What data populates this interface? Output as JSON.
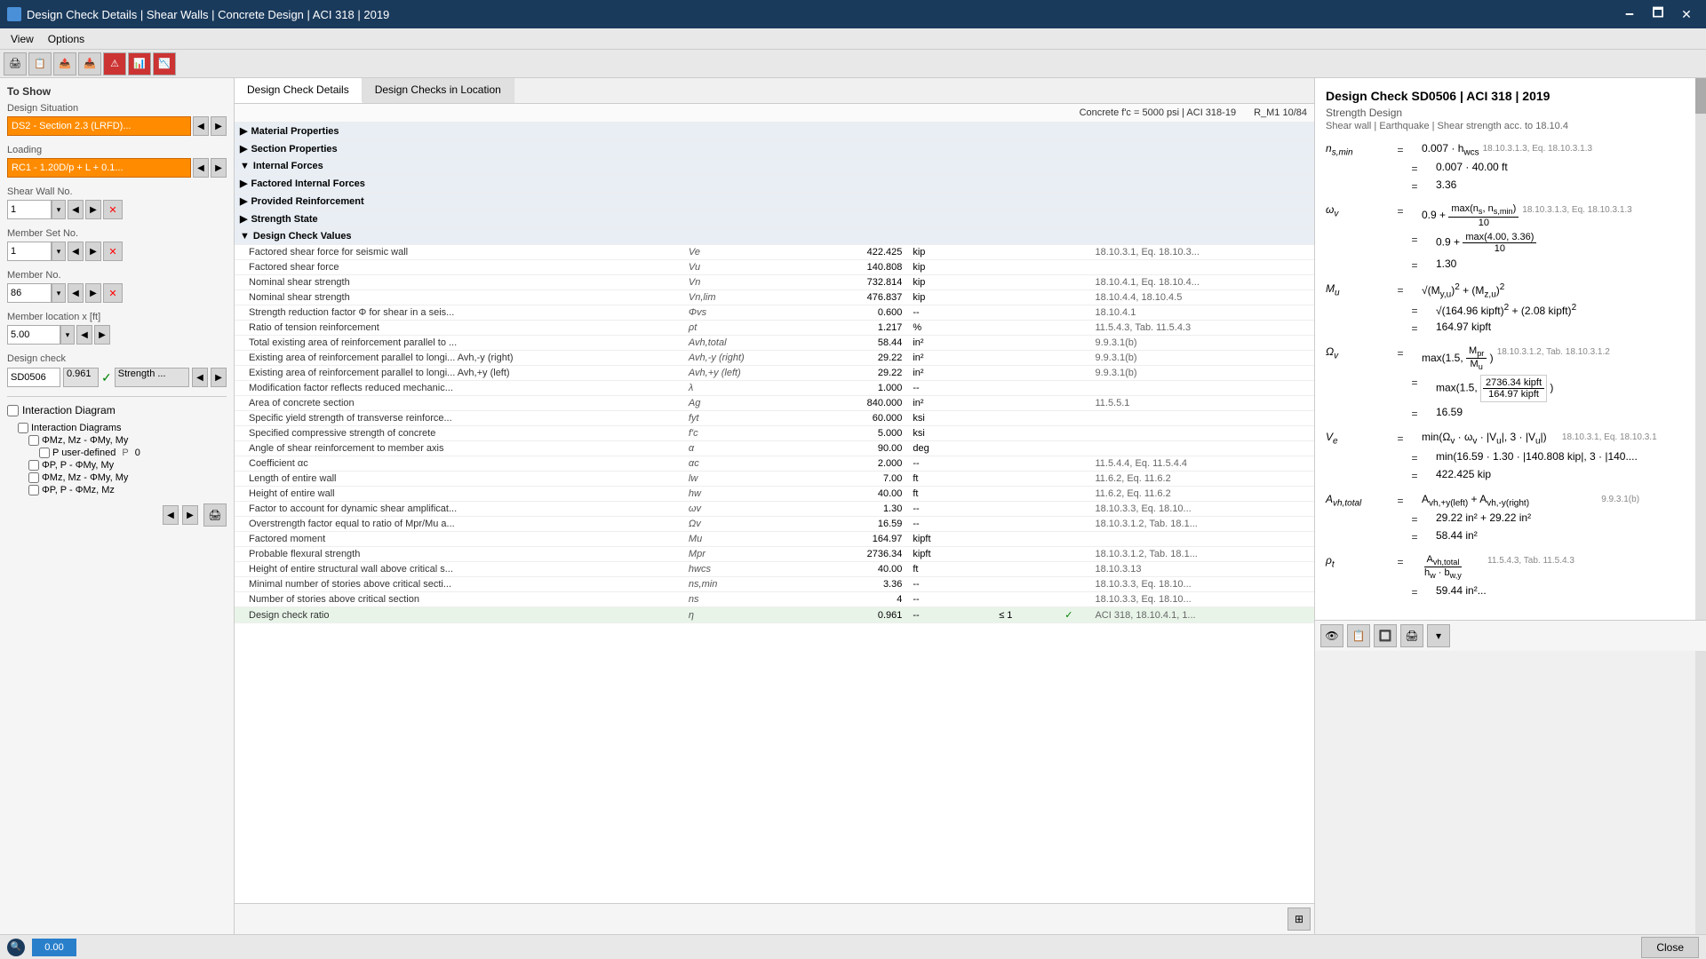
{
  "titleBar": {
    "title": "Design Check Details | Shear Walls | Concrete Design | ACI 318 | 2019",
    "minimize": "🗕",
    "maximize": "🗖",
    "close": "✕"
  },
  "menu": {
    "items": [
      "View",
      "Options"
    ]
  },
  "tabs": {
    "tab1": "Design Check Details",
    "tab2": "Design Checks in Location"
  },
  "infoBar": {
    "left": "Concrete f'c = 5000 psi | ACI 318-19",
    "right": "R_M1 10/84"
  },
  "toShow": {
    "header": "To Show",
    "situation": {
      "label": "Design Situation",
      "value": "DS2 - Section 2.3 (LRFD)..."
    },
    "loading": {
      "label": "Loading",
      "value": "RC1 - 1.20D/p + L + 0.1..."
    },
    "shearWall": {
      "label": "Shear Wall No.",
      "value": "1"
    },
    "memberSet": {
      "label": "Member Set No.",
      "value": "1"
    },
    "member": {
      "label": "Member No.",
      "value": "86"
    },
    "location": {
      "label": "Member location x [ft]",
      "value": "5.00"
    },
    "designCheck": {
      "label": "Design check",
      "code": "SD0506",
      "ratio": "0.961",
      "strength": "Strength ..."
    }
  },
  "interactionDiagram": {
    "label": "Interaction Diagram",
    "items": [
      "Interaction Diagrams",
      "ΦMz, Mz - ΦMy, My",
      "P user-defined",
      "ΦP, P - ΦMy, My",
      "ΦMz, Mz - ΦMy, My",
      "ΦP, P - ΦMz, Mz"
    ]
  },
  "sections": [
    {
      "id": "material",
      "label": "Material Properties",
      "expanded": false
    },
    {
      "id": "section",
      "label": "Section Properties",
      "expanded": false
    },
    {
      "id": "internal",
      "label": "Internal Forces",
      "expanded": true
    },
    {
      "id": "factored",
      "label": "Factored Internal Forces",
      "expanded": false
    },
    {
      "id": "provided",
      "label": "Provided Reinforcement",
      "expanded": false
    },
    {
      "id": "strength",
      "label": "Strength State",
      "expanded": false
    },
    {
      "id": "dcvalues",
      "label": "Design Check Values",
      "expanded": true
    }
  ],
  "tableRows": [
    {
      "name": "Factored shear force for seismic wall",
      "sym": "Ve",
      "val": "422.425",
      "unit": "kip",
      "limit": "",
      "status": "",
      "ref": "18.10.3.1, Eq. 18.10.3..."
    },
    {
      "name": "Factored shear force",
      "sym": "Vu",
      "val": "140.808",
      "unit": "kip",
      "limit": "",
      "status": "",
      "ref": ""
    },
    {
      "name": "Nominal shear strength",
      "sym": "Vn",
      "val": "732.814",
      "unit": "kip",
      "limit": "",
      "status": "",
      "ref": "18.10.4.1, Eq. 18.10.4..."
    },
    {
      "name": "Nominal shear strength",
      "sym": "Vn,lim",
      "val": "476.837",
      "unit": "kip",
      "limit": "",
      "status": "",
      "ref": "18.10.4.4, 18.10.4.5"
    },
    {
      "name": "Strength reduction factor Φ for shear in a seis...",
      "sym": "Φvs",
      "val": "0.600",
      "unit": "--",
      "limit": "",
      "status": "",
      "ref": "18.10.4.1"
    },
    {
      "name": "Ratio of tension reinforcement",
      "sym": "ρt",
      "val": "1.217",
      "unit": "%",
      "limit": "",
      "status": "",
      "ref": "11.5.4.3, Tab. 11.5.4.3"
    },
    {
      "name": "Total existing area of reinforcement parallel to ...",
      "sym": "Avh,total",
      "val": "58.44",
      "unit": "in²",
      "limit": "",
      "status": "",
      "ref": "9.9.3.1(b)"
    },
    {
      "name": "Existing area of reinforcement parallel to longi... Avh,-y (right)",
      "sym": "Avh,-y (right)",
      "val": "29.22",
      "unit": "in²",
      "limit": "",
      "status": "",
      "ref": "9.9.3.1(b)"
    },
    {
      "name": "Existing area of reinforcement parallel to longi... Avh,+y (left)",
      "sym": "Avh,+y (left)",
      "val": "29.22",
      "unit": "in²",
      "limit": "",
      "status": "",
      "ref": "9.9.3.1(b)"
    },
    {
      "name": "Modification factor reflects reduced mechanic...",
      "sym": "λ",
      "val": "1.000",
      "unit": "--",
      "limit": "",
      "status": "",
      "ref": ""
    },
    {
      "name": "Area of concrete section",
      "sym": "Ag",
      "val": "840.000",
      "unit": "in²",
      "limit": "",
      "status": "",
      "ref": "11.5.5.1"
    },
    {
      "name": "Specific yield strength of transverse reinforce...",
      "sym": "fyt",
      "val": "60.000",
      "unit": "ksi",
      "limit": "",
      "status": "",
      "ref": ""
    },
    {
      "name": "Specified compressive strength of concrete",
      "sym": "f'c",
      "val": "5.000",
      "unit": "ksi",
      "limit": "",
      "status": "",
      "ref": ""
    },
    {
      "name": "Angle of shear reinforcement to member axis",
      "sym": "α",
      "val": "90.00",
      "unit": "deg",
      "limit": "",
      "status": "",
      "ref": ""
    },
    {
      "name": "Coefficient αc",
      "sym": "αc",
      "val": "2.000",
      "unit": "--",
      "limit": "",
      "status": "",
      "ref": "11.5.4.4, Eq. 11.5.4.4"
    },
    {
      "name": "Length of entire wall",
      "sym": "lw",
      "val": "7.00",
      "unit": "ft",
      "limit": "",
      "status": "",
      "ref": "11.6.2, Eq. 11.6.2"
    },
    {
      "name": "Height of entire wall",
      "sym": "hw",
      "val": "40.00",
      "unit": "ft",
      "limit": "",
      "status": "",
      "ref": "11.6.2, Eq. 11.6.2"
    },
    {
      "name": "Factor to account for dynamic shear amplificat...",
      "sym": "ωv",
      "val": "1.30",
      "unit": "--",
      "limit": "",
      "status": "",
      "ref": "18.10.3.3, Eq. 18.10..."
    },
    {
      "name": "Overstrength factor equal to ratio of Mpr/Mu a...",
      "sym": "Ωv",
      "val": "16.59",
      "unit": "--",
      "limit": "",
      "status": "",
      "ref": "18.10.3.1.2, Tab. 18.1..."
    },
    {
      "name": "Factored moment",
      "sym": "Mu",
      "val": "164.97",
      "unit": "kipft",
      "limit": "",
      "status": "",
      "ref": ""
    },
    {
      "name": "Probable flexural strength",
      "sym": "Mpr",
      "val": "2736.34",
      "unit": "kipft",
      "limit": "",
      "status": "",
      "ref": "18.10.3.1.2, Tab. 18.1..."
    },
    {
      "name": "Height of entire structural wall above critical s...",
      "sym": "hwcs",
      "val": "40.00",
      "unit": "ft",
      "limit": "",
      "status": "",
      "ref": "18.10.3.13"
    },
    {
      "name": "Minimal number of stories above critical secti...",
      "sym": "ns,min",
      "val": "3.36",
      "unit": "--",
      "limit": "",
      "status": "",
      "ref": "18.10.3.3, Eq. 18.10..."
    },
    {
      "name": "Number of stories above critical section",
      "sym": "ns",
      "val": "4",
      "unit": "--",
      "limit": "",
      "status": "",
      "ref": "18.10.3.3, Eq. 18.10..."
    },
    {
      "name": "Design check ratio",
      "sym": "η",
      "val": "0.961",
      "unit": "--",
      "limit": "≤ 1",
      "status": "✓",
      "ref": "ACI 318, 18.10.4.1, 1..."
    }
  ],
  "rightPanel": {
    "title": "Design Check SD0506 | ACI 318 | 2019",
    "subtitle1": "Strength Design",
    "subtitle2": "Shear wall | Earthquake | Shear strength acc. to 18.10.4",
    "formulas": [
      {
        "var": "ns,min",
        "eq": "=",
        "content": "0.007 · hwcs",
        "ref": "18.10.3.1.3, Eq. 18.10.3.1.3"
      },
      {
        "var": "",
        "eq": "=",
        "content": "0.007 · 40.00 ft",
        "ref": ""
      },
      {
        "var": "",
        "eq": "=",
        "content": "3.36",
        "ref": ""
      }
    ]
  },
  "statusBar": {
    "searchValue": "0.00",
    "closeLabel": "Close"
  }
}
